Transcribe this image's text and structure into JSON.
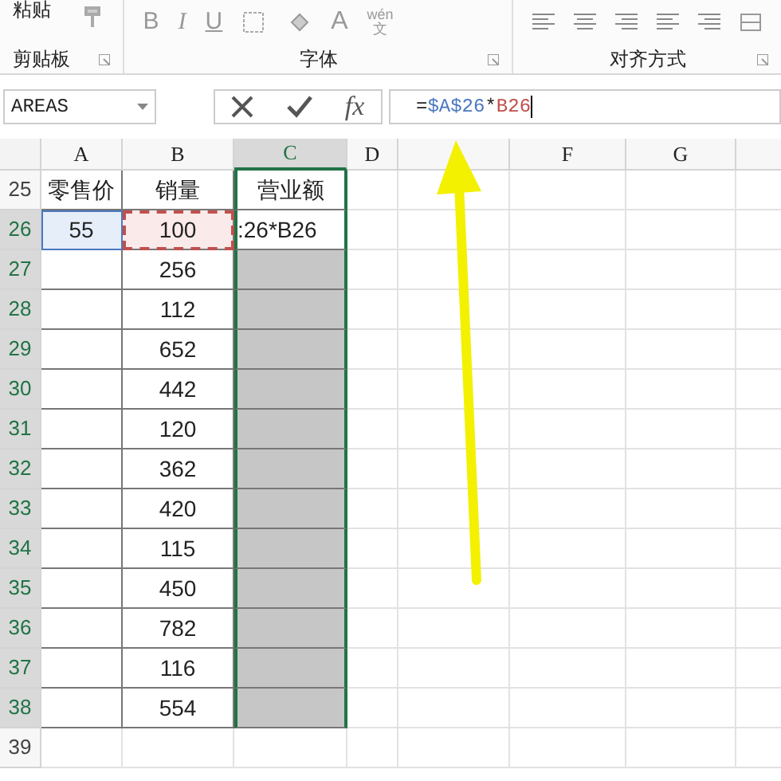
{
  "ribbon": {
    "paste_label": "粘贴",
    "font_buttons": [
      "B",
      "I",
      "U"
    ],
    "font_color_label": "A",
    "phonetic_label": "wén",
    "phonetic_char": "文",
    "groups": [
      {
        "label": "剪贴板"
      },
      {
        "label": "字体"
      },
      {
        "label": "对齐方式"
      }
    ]
  },
  "formula_bar": {
    "name_box": "AREAS",
    "fx_label": "fx",
    "formula_parts": [
      {
        "text": "=",
        "color": "#222222"
      },
      {
        "text": "$A$26",
        "color": "#4a78c0"
      },
      {
        "text": "*",
        "color": "#222222"
      },
      {
        "text": "B26",
        "color": "#c0504d"
      }
    ]
  },
  "columns": [
    {
      "label": "A",
      "selected": false
    },
    {
      "label": "B",
      "selected": false
    },
    {
      "label": "C",
      "selected": true
    },
    {
      "label": "D",
      "selected": false
    },
    {
      "selected": false
    },
    {
      "label": "F",
      "selected": false
    },
    {
      "label": "G",
      "selected": false
    }
  ],
  "rows": [
    {
      "number": "25",
      "selected": false,
      "cells": [
        {
          "text": "零售价",
          "kind": "header"
        },
        {
          "text": "销量",
          "kind": "header"
        },
        {
          "text": "营业额",
          "kind": "header"
        }
      ]
    },
    {
      "number": "26",
      "selected": true,
      "cells": [
        {
          "text": "55",
          "kind": "ref_abs"
        },
        {
          "text": "100",
          "kind": "ref_rel"
        },
        {
          "text": ":26*B26",
          "kind": "editing"
        }
      ]
    },
    {
      "number": "27",
      "selected": true,
      "cells": [
        {
          "text": "",
          "kind": "plain"
        },
        {
          "text": "256",
          "kind": "plain"
        },
        {
          "text": "",
          "kind": "selected"
        }
      ]
    },
    {
      "number": "28",
      "selected": true,
      "cells": [
        {
          "text": "",
          "kind": "plain"
        },
        {
          "text": "112",
          "kind": "plain"
        },
        {
          "text": "",
          "kind": "selected"
        }
      ]
    },
    {
      "number": "29",
      "selected": true,
      "cells": [
        {
          "text": "",
          "kind": "plain"
        },
        {
          "text": "652",
          "kind": "plain"
        },
        {
          "text": "",
          "kind": "selected"
        }
      ]
    },
    {
      "number": "30",
      "selected": true,
      "cells": [
        {
          "text": "",
          "kind": "plain"
        },
        {
          "text": "442",
          "kind": "plain"
        },
        {
          "text": "",
          "kind": "selected"
        }
      ]
    },
    {
      "number": "31",
      "selected": true,
      "cells": [
        {
          "text": "",
          "kind": "plain"
        },
        {
          "text": "120",
          "kind": "plain"
        },
        {
          "text": "",
          "kind": "selected"
        }
      ]
    },
    {
      "number": "32",
      "selected": true,
      "cells": [
        {
          "text": "",
          "kind": "plain"
        },
        {
          "text": "362",
          "kind": "plain"
        },
        {
          "text": "",
          "kind": "selected"
        }
      ]
    },
    {
      "number": "33",
      "selected": true,
      "cells": [
        {
          "text": "",
          "kind": "plain"
        },
        {
          "text": "420",
          "kind": "plain"
        },
        {
          "text": "",
          "kind": "selected"
        }
      ]
    },
    {
      "number": "34",
      "selected": true,
      "cells": [
        {
          "text": "",
          "kind": "plain"
        },
        {
          "text": "115",
          "kind": "plain"
        },
        {
          "text": "",
          "kind": "selected"
        }
      ]
    },
    {
      "number": "35",
      "selected": true,
      "cells": [
        {
          "text": "",
          "kind": "plain"
        },
        {
          "text": "450",
          "kind": "plain"
        },
        {
          "text": "",
          "kind": "selected"
        }
      ]
    },
    {
      "number": "36",
      "selected": true,
      "cells": [
        {
          "text": "",
          "kind": "plain"
        },
        {
          "text": "782",
          "kind": "plain"
        },
        {
          "text": "",
          "kind": "selected"
        }
      ]
    },
    {
      "number": "37",
      "selected": true,
      "cells": [
        {
          "text": "",
          "kind": "plain"
        },
        {
          "text": "116",
          "kind": "plain"
        },
        {
          "text": "",
          "kind": "selected"
        }
      ]
    },
    {
      "number": "38",
      "selected": true,
      "cells": [
        {
          "text": "",
          "kind": "plain"
        },
        {
          "text": "554",
          "kind": "plain"
        },
        {
          "text": "",
          "kind": "selected"
        }
      ]
    },
    {
      "number": "39",
      "selected": false,
      "cells": []
    }
  ]
}
